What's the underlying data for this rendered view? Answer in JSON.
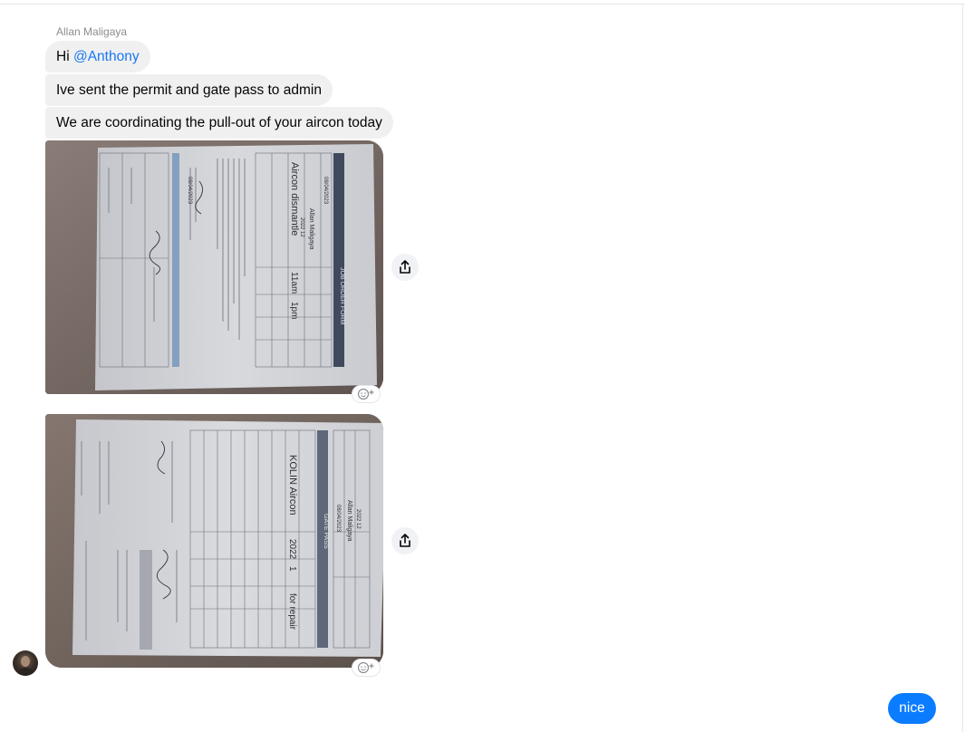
{
  "conversation": {
    "sender_name": "Allan Maligaya",
    "messages": {
      "greeting_prefix": "Hi ",
      "greeting_mention": "@Anthony",
      "permit_text": "Ive sent the permit and gate pass to admin",
      "coordination_text": "We are coordinating the pull-out of your aircon today"
    },
    "photo1": {
      "doc_date": "08/04/2023",
      "doc_name": "Allan Maligaya",
      "doc_unit": "2022 12",
      "doc_heading": "JOB ORDER FORM",
      "doc_work": "Aircon dismantle",
      "doc_time_start": "11am",
      "doc_time_end": "1pm",
      "doc_sign_date": "08/04/2023"
    },
    "photo2": {
      "doc_heading": "GATE PASS",
      "doc_date": "08/04/2023",
      "doc_name": "Allan Maligaya",
      "doc_unit": "2022 12",
      "doc_item": "KOLIN Aircon",
      "doc_unit_no": "2022",
      "doc_qty": "1",
      "doc_purpose": "for repair"
    },
    "my_reply": "nice"
  },
  "icons": {
    "share": "share-icon",
    "reaction": "add-reaction-icon",
    "avatar": "contact-avatar"
  },
  "colors": {
    "bubble_gray": "#f0f0f0",
    "bubble_blue": "#0a7cff",
    "mention_blue": "#1877f2"
  }
}
